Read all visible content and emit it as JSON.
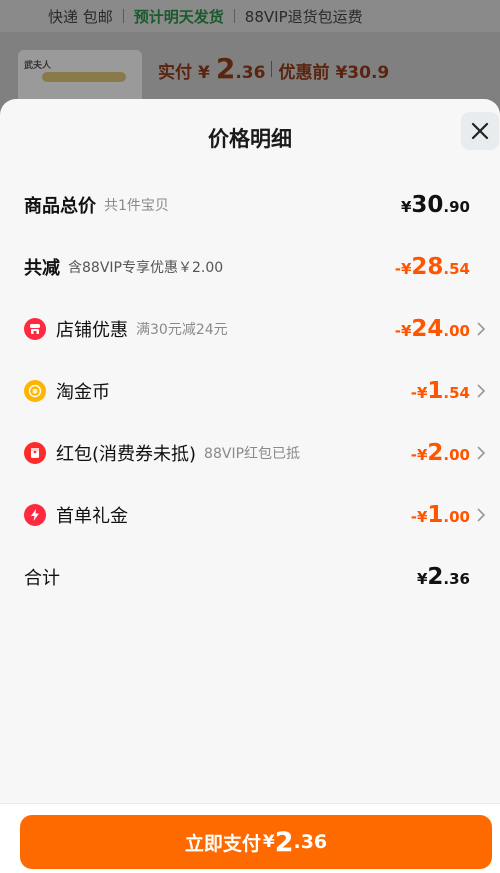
{
  "background": {
    "bar": {
      "left_text": "快递 包邮",
      "highlight": "预计明天发货",
      "right_text": "88VIP退货包运费"
    },
    "thumb_label": "武夫人",
    "price": {
      "paid_label": "实付",
      "currency": "¥",
      "int": "2",
      "dec": ".36",
      "before_label": "优惠前",
      "before_value": "¥30.9"
    }
  },
  "sheet": {
    "title": "价格明细",
    "close_icon": "close-icon",
    "rows": [
      {
        "label": "商品总价",
        "sub": "共1件宝贝",
        "cur": "¥",
        "int": "30",
        "dec": ".90"
      },
      {
        "label": "共减",
        "sub": "含88VIP专享优惠￥2.00",
        "cur": "-¥",
        "int": "28",
        "dec": ".54"
      },
      {
        "label": "店铺优惠",
        "sub": "满30元减24元",
        "cur": "-¥",
        "int": "24",
        "dec": ".00",
        "icon": "store-icon"
      },
      {
        "label": "淘金币",
        "sub": "",
        "cur": "-¥",
        "int": "1",
        "dec": ".54",
        "icon": "coin-icon"
      },
      {
        "label": "红包(消费券未抵)",
        "sub": "88VIP红包已抵",
        "cur": "-¥",
        "int": "2",
        "dec": ".00",
        "icon": "red-packet-icon"
      },
      {
        "label": "首单礼金",
        "sub": "",
        "cur": "-¥",
        "int": "1",
        "dec": ".00",
        "icon": "lightning-icon"
      },
      {
        "label": "合计",
        "sub": "",
        "cur": "¥",
        "int": "2",
        "dec": ".36"
      }
    ],
    "pay_button": {
      "label": "立即支付",
      "cur": "¥",
      "int": "2",
      "dec": ".36"
    }
  },
  "colors": {
    "accent": "#ff5500",
    "button": "#ff6a00"
  }
}
